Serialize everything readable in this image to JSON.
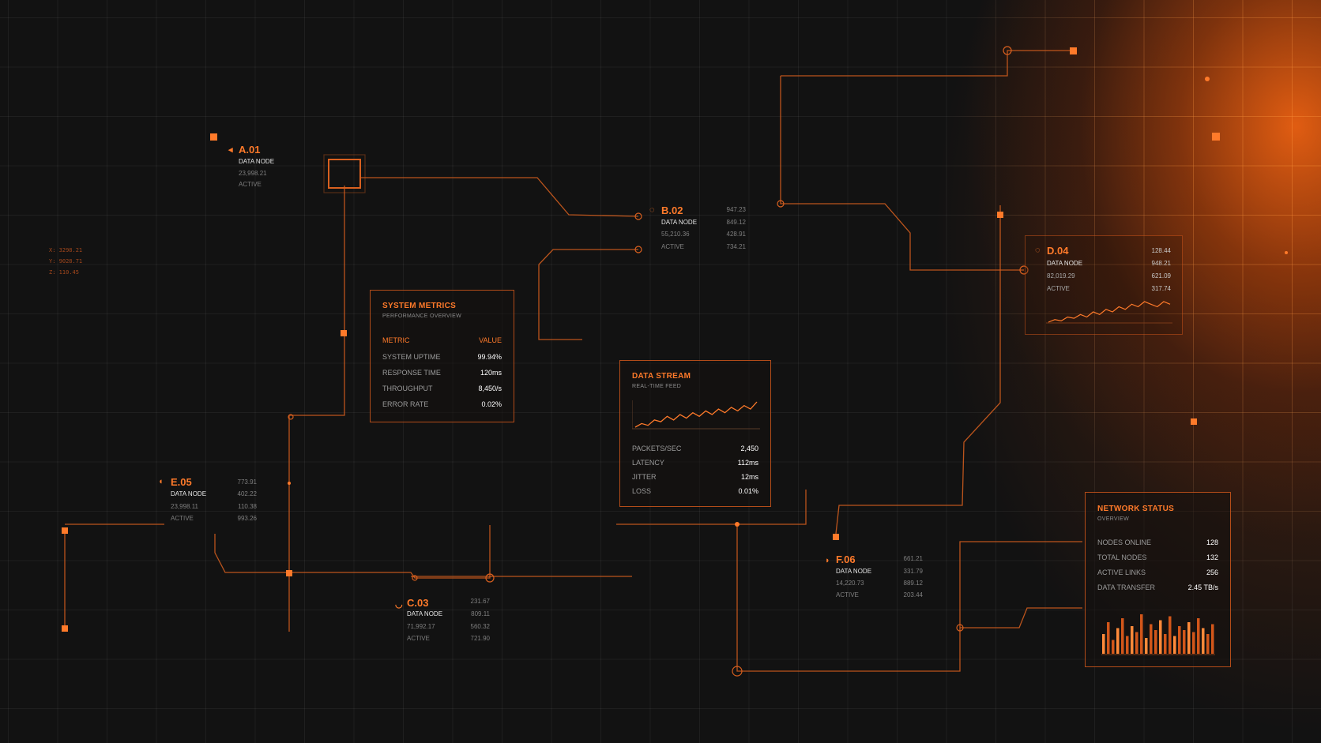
{
  "accent_color": "#ff7a2a",
  "nodes": {
    "a01": {
      "id": "A.01",
      "type": "DATA NODE",
      "value": "23,998.21",
      "status": "ACTIVE"
    },
    "b02": {
      "id": "B.02",
      "type": "DATA NODE",
      "value": "55,210.36",
      "status": "ACTIVE",
      "metrics": [
        "947.23",
        "849.12",
        "428.91",
        "734.21"
      ]
    },
    "c03": {
      "id": "C.03",
      "type": "DATA NODE",
      "value": "71,992.17",
      "status": "ACTIVE",
      "metrics": [
        "231.67",
        "809.11",
        "560.32",
        "721.90"
      ]
    },
    "d04": {
      "id": "D.04",
      "type": "DATA NODE",
      "value": "82,019.29",
      "status": "ACTIVE",
      "metrics": [
        "128.44",
        "948.21",
        "621.09",
        "317.74"
      ]
    },
    "e05": {
      "id": "E.05",
      "type": "DATA NODE",
      "value": "23,998.11",
      "status": "ACTIVE",
      "metrics": [
        "773.91",
        "402.22",
        "110.38",
        "993.26"
      ]
    },
    "f06": {
      "id": "F.06",
      "type": "DATA NODE",
      "value": "14,220.73",
      "status": "ACTIVE",
      "metrics": [
        "661.21",
        "331.79",
        "889.12",
        "203.44"
      ]
    }
  },
  "coords": {
    "x": "X: 3298.21",
    "y": "Y: 9028.71",
    "z": "Z: 110.45"
  },
  "system_metrics": {
    "title": "SYSTEM METRICS",
    "subtitle": "PERFORMANCE OVERVIEW",
    "col_metric": "METRIC",
    "col_value": "VALUE",
    "rows": [
      {
        "label": "SYSTEM UPTIME",
        "value": "99.94%"
      },
      {
        "label": "RESPONSE TIME",
        "value": "120ms"
      },
      {
        "label": "THROUGHPUT",
        "value": "8,450/s"
      },
      {
        "label": "ERROR RATE",
        "value": "0.02%"
      }
    ]
  },
  "data_stream": {
    "title": "DATA STREAM",
    "subtitle": "REAL-TIME FEED",
    "rows": [
      {
        "label": "PACKETS/SEC",
        "value": "2,450"
      },
      {
        "label": "LATENCY",
        "value": "112ms"
      },
      {
        "label": "JITTER",
        "value": "12ms"
      },
      {
        "label": "LOSS",
        "value": "0.01%"
      }
    ],
    "spark": [
      3,
      4,
      3.5,
      5,
      4.5,
      6,
      5,
      6.5,
      5.5,
      7,
      6,
      7.5,
      6.5,
      8,
      7,
      8.5,
      7.5,
      9,
      8,
      10
    ]
  },
  "network_status": {
    "title": "NETWORK STATUS",
    "subtitle": "OVERVIEW",
    "rows": [
      {
        "label": "NODES ONLINE",
        "value": "128"
      },
      {
        "label": "TOTAL NODES",
        "value": "132"
      },
      {
        "label": "ACTIVE LINKS",
        "value": "256"
      },
      {
        "label": "DATA TRANSFER",
        "value": "2.45 TB/s"
      }
    ],
    "bars": [
      0.5,
      0.8,
      0.35,
      0.65,
      0.9,
      0.45,
      0.7,
      0.55,
      1.0,
      0.4,
      0.75,
      0.6,
      0.85,
      0.5,
      0.95,
      0.45,
      0.7,
      0.6,
      0.8,
      0.55,
      0.9,
      0.65,
      0.5,
      0.75
    ]
  },
  "d04_spark": [
    2,
    3,
    2.5,
    4,
    3.5,
    5,
    4,
    6,
    5,
    7,
    6,
    8,
    7,
    9,
    8,
    10,
    9,
    8,
    10,
    9
  ]
}
